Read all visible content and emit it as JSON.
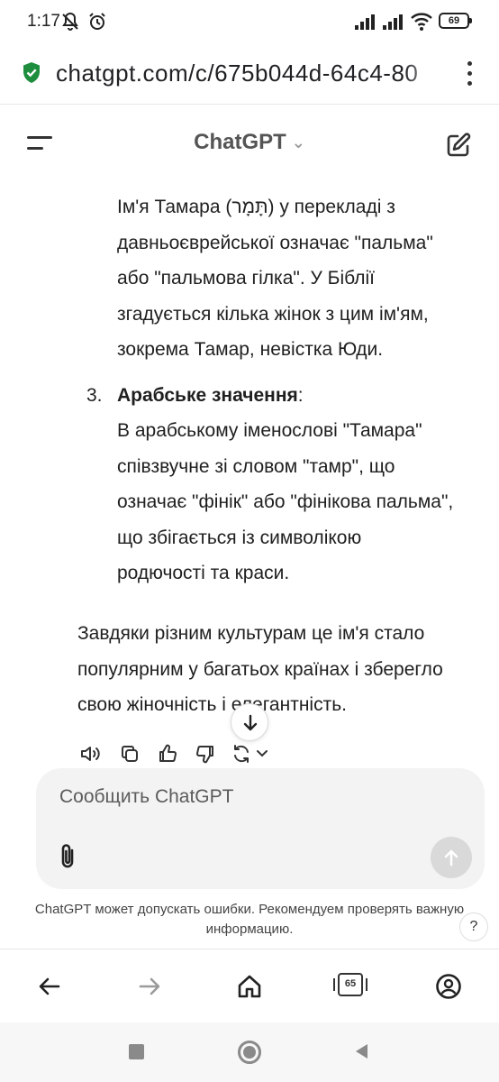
{
  "status_bar": {
    "time": "1:17",
    "battery": "69"
  },
  "browser": {
    "url": "chatgpt.com/c/675b044d-64c4-80",
    "tab_count": "65"
  },
  "app": {
    "title": "ChatGPT"
  },
  "message": {
    "lines": [
      "Ім'я Тамара (תָּמָר) у перекладі з",
      "давньоєврейської означає \"пальма\"",
      "або \"пальмова гілка\". У Біблії",
      "згадується кілька жінок з цим ім'ям,",
      "зокрема Тамар, невістка Юди."
    ],
    "item3": {
      "number": "3.",
      "heading": "Арабське значення",
      "heading_suffix": ":",
      "lines": [
        "В арабському іменослові \"Тамара\"",
        "співзвучне зі словом \"тамр\", що",
        "означає \"фінік\" або \"фінікова пальма\",",
        "що збігається із символікою",
        "родючості та краси."
      ]
    },
    "conclusion": [
      "Завдяки різним культурам це ім'я стало",
      "популярним у багатьох країнах і зберегло",
      "свою жіночність і елегантність."
    ]
  },
  "composer": {
    "placeholder": "Сообщить ChatGPT"
  },
  "disclaimer": "ChatGPT может допускать ошибки. Рекомендуем проверять важную информацию.",
  "help_label": "?",
  "colors": {
    "shield": "#1e8e3e",
    "text": "#1f1f1f",
    "composer_bg": "#f3f3f3",
    "send_bg": "#d9d9d9"
  }
}
